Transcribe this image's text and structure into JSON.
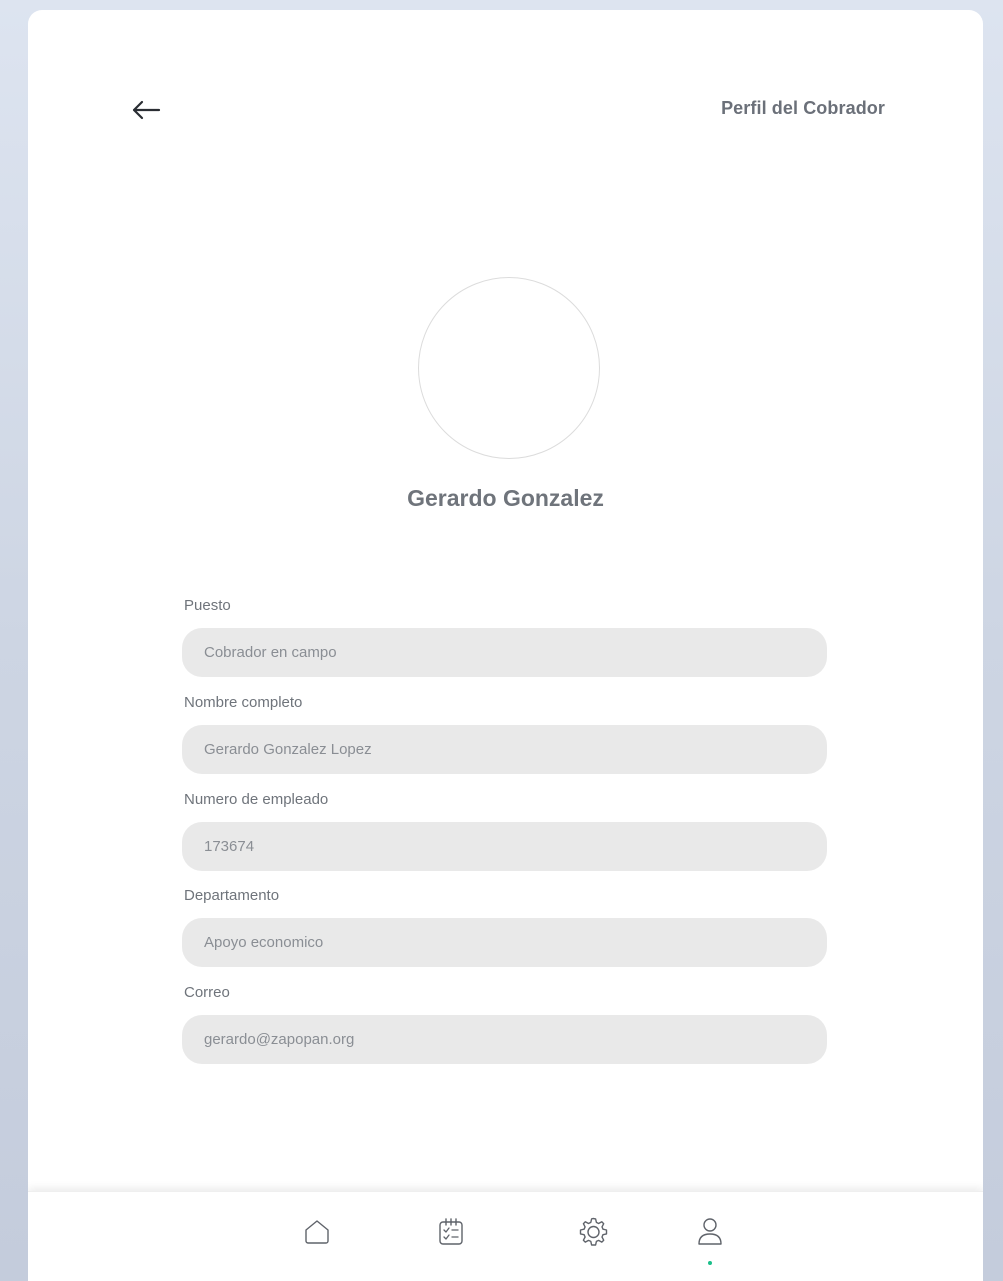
{
  "header": {
    "back_icon": "arrow-left-icon",
    "title": "Perfil del Cobrador"
  },
  "profile": {
    "avatar_icon": "avatar-placeholder",
    "name": "Gerardo Gonzalez"
  },
  "fields": [
    {
      "label": "Puesto",
      "value": "Cobrador en campo"
    },
    {
      "label": "Nombre completo",
      "value": "Gerardo Gonzalez Lopez"
    },
    {
      "label": "Numero de empleado",
      "value": "173674"
    },
    {
      "label": "Departamento",
      "value": "Apoyo economico"
    },
    {
      "label": "Correo",
      "value": "gerardo@zapopan.org"
    }
  ],
  "bottom_nav": {
    "items": [
      {
        "icon": "home-icon",
        "active": false
      },
      {
        "icon": "calendar-checklist-icon",
        "active": false
      },
      {
        "icon": "gear-icon",
        "active": false
      },
      {
        "icon": "user-icon",
        "active": true
      }
    ],
    "active_color": "#1bbf8a"
  },
  "colors": {
    "title_text": "#6b7079",
    "input_background": "#e9e9e9",
    "background_gradient_top": "#dde4f0"
  }
}
